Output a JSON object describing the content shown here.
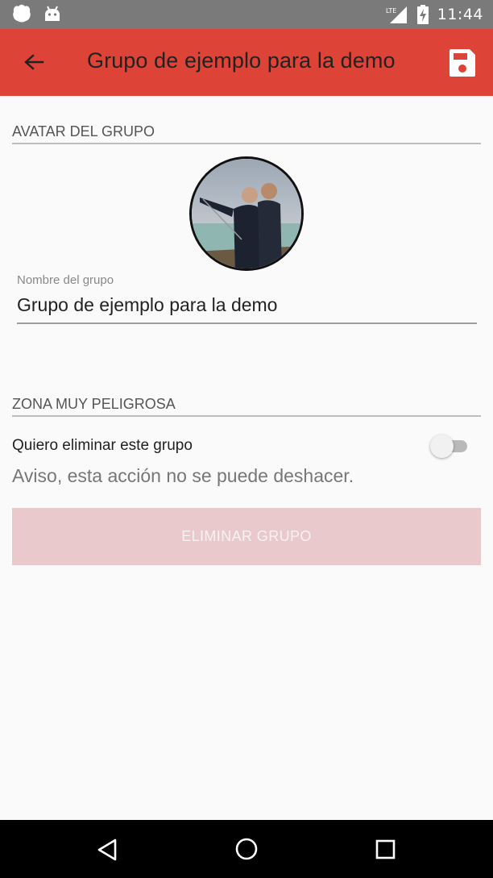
{
  "status_bar": {
    "time": "11:44",
    "network": "LTE",
    "icons": [
      "notification-icon",
      "android-icon",
      "signal-icon",
      "battery-charging-icon"
    ]
  },
  "app_bar": {
    "title": "Grupo de ejemplo para la demo",
    "back_icon": "arrow-back-icon",
    "save_icon": "save-icon",
    "color": "#de4337"
  },
  "avatar_section": {
    "header": "AVATAR DEL GRUPO"
  },
  "group_name": {
    "label": "Nombre del grupo",
    "value": "Grupo de ejemplo para la demo"
  },
  "danger_zone": {
    "header": "ZONA MUY PELIGROSA",
    "toggle_label": "Quiero eliminar este grupo",
    "toggle_on": false,
    "warning": "Aviso, esta acción no se puede deshacer.",
    "delete_button": "ELIMINAR GRUPO",
    "delete_button_color": "#e9c9cb"
  },
  "nav_bar": {
    "icons": [
      "nav-back-icon",
      "nav-home-icon",
      "nav-recents-icon"
    ]
  }
}
